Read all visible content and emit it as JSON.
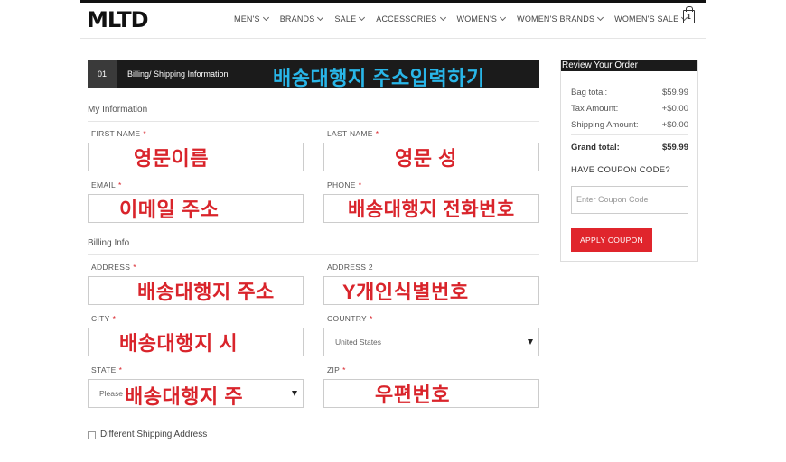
{
  "header": {
    "logo": "MLTD",
    "nav": [
      "MEN'S",
      "BRANDS",
      "SALE",
      "ACCESSORIES",
      "WOMEN'S",
      "WOMEN'S BRANDS",
      "WOMEN'S SALE"
    ],
    "bag_count": "1"
  },
  "step": {
    "number": "01",
    "title": "Billing/ Shipping Information",
    "annotation": "배송대행지 주소입력하기"
  },
  "my_info": {
    "title": "My Information",
    "first_name": {
      "label": "FIRST NAME",
      "annotation": "영문이름"
    },
    "last_name": {
      "label": "LAST NAME",
      "annotation": "영문 성"
    },
    "email": {
      "label": "EMAIL",
      "annotation": "이메일 주소"
    },
    "phone": {
      "label": "PHONE",
      "annotation": "배송대행지 전화번호"
    }
  },
  "billing": {
    "title": "Billing Info",
    "address": {
      "label": "ADDRESS",
      "annotation": "배송대행지 주소"
    },
    "address2": {
      "label": "ADDRESS 2",
      "annotation": "Y개인식별번호"
    },
    "city": {
      "label": "CITY",
      "annotation": "배송대행지 시"
    },
    "country": {
      "label": "COUNTRY",
      "value": "United States"
    },
    "state": {
      "label": "STATE",
      "placeholder": "Please",
      "annotation": "배송대행지 주"
    },
    "zip": {
      "label": "ZIP",
      "annotation": "우편번호"
    }
  },
  "different_shipping": "Different Shipping Address",
  "summary": {
    "title": "Review Your Order",
    "bag_total": {
      "label": "Bag total:",
      "value": "$59.99"
    },
    "tax": {
      "label": "Tax Amount:",
      "value": "+$0.00"
    },
    "shipping": {
      "label": "Shipping Amount:",
      "value": "+$0.00"
    },
    "grand": {
      "label": "Grand total:",
      "value": "$59.99"
    },
    "coupon_heading": "HAVE COUPON CODE?",
    "coupon_placeholder": "Enter Coupon Code",
    "coupon_button": "APPLY COUPON"
  },
  "colors": {
    "accent": "#e0252c",
    "annotation_red": "#d9242b",
    "annotation_blue": "#29b6e8",
    "dark": "#1b1b1b"
  }
}
